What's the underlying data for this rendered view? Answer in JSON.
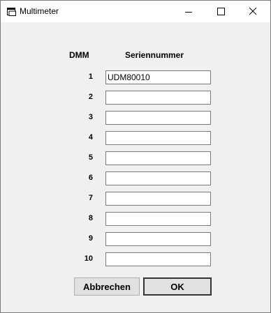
{
  "window": {
    "title": "Multimeter",
    "icon": "window-app-icon"
  },
  "table": {
    "header_dmm": "DMM",
    "header_serial": "Seriennummer",
    "rows": [
      {
        "label": "1",
        "value": "UDM80010"
      },
      {
        "label": "2",
        "value": ""
      },
      {
        "label": "3",
        "value": ""
      },
      {
        "label": "4",
        "value": ""
      },
      {
        "label": "5",
        "value": ""
      },
      {
        "label": "6",
        "value": ""
      },
      {
        "label": "7",
        "value": ""
      },
      {
        "label": "8",
        "value": ""
      },
      {
        "label": "9",
        "value": ""
      },
      {
        "label": "10",
        "value": ""
      }
    ]
  },
  "buttons": {
    "cancel": "Abbrechen",
    "ok": "OK"
  }
}
